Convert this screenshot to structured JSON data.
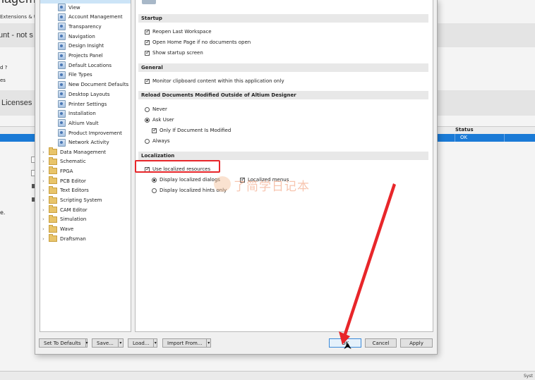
{
  "background": {
    "title_fragment": "nagem",
    "subtitle_fragment": "Extensions & U",
    "account_fragment": "unt - not s",
    "question_fragment": "d ?",
    "es_fragment": "es",
    "licenses_label": "Licenses",
    "status_header": "Status",
    "status_value": "OK",
    "dot_fragment": "e.",
    "sys_fragment": "Syst"
  },
  "tree": {
    "items": [
      {
        "label": "View"
      },
      {
        "label": "Account Management"
      },
      {
        "label": "Transparency"
      },
      {
        "label": "Navigation"
      },
      {
        "label": "Design Insight"
      },
      {
        "label": "Projects Panel"
      },
      {
        "label": "Default Locations"
      },
      {
        "label": "File Types"
      },
      {
        "label": "New Document Defaults"
      },
      {
        "label": "Desktop Layouts"
      },
      {
        "label": "Printer Settings"
      },
      {
        "label": "Installation"
      },
      {
        "label": "Altium Vault"
      },
      {
        "label": "Product Improvement"
      },
      {
        "label": "Network Activity"
      }
    ],
    "folders": [
      {
        "label": "Data Management"
      },
      {
        "label": "Schematic"
      },
      {
        "label": "FPGA"
      },
      {
        "label": "PCB Editor"
      },
      {
        "label": "Text Editors"
      },
      {
        "label": "Scripting System"
      },
      {
        "label": "CAM Editor"
      },
      {
        "label": "Simulation"
      },
      {
        "label": "Wave"
      },
      {
        "label": "Draftsman"
      }
    ]
  },
  "startup": {
    "heading": "Startup",
    "reopen": "Reopen Last Workspace",
    "open_home": "Open Home Page if no documents open",
    "show_startup": "Show startup screen"
  },
  "general": {
    "heading": "General",
    "monitor": "Monitor clipboard content within this application only"
  },
  "reload": {
    "heading": "Reload Documents Modified Outside of Altium Designer",
    "never": "Never",
    "ask_user": "Ask User",
    "only_if": "Only If Document Is Modified",
    "always": "Always"
  },
  "localization": {
    "heading": "Localization",
    "use_localized": "Use localized resources",
    "display_dialogs": "Display localized dialogs",
    "localized_menus": "Localized menus",
    "display_hints": "Display localized hints only"
  },
  "watermark": "了简学日记本",
  "buttons": {
    "set_defaults": "Set To Defaults",
    "save": "Save...",
    "load": "Load...",
    "import_from": "Import From...",
    "ok": "OK",
    "cancel": "Cancel",
    "apply": "Apply",
    "dropdown_glyph": "▾"
  },
  "colors": {
    "highlight_box": "#e8262a",
    "selection_blue": "#1a7ad6",
    "arrow": "#e8262a"
  }
}
